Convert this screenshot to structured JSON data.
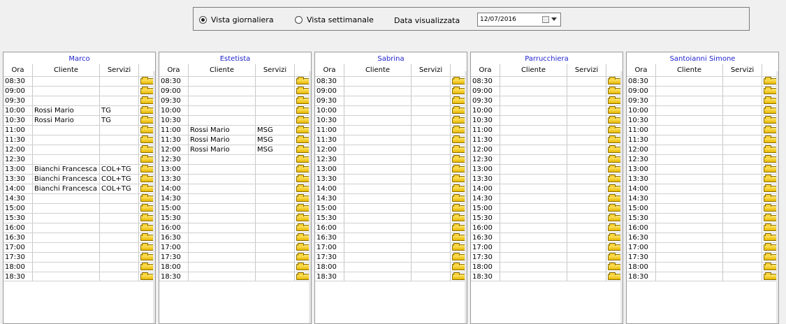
{
  "toolbar": {
    "view_daily_label": "Vista giornaliera",
    "view_daily_selected": true,
    "view_weekly_label": "Vista settimanale",
    "view_weekly_selected": false,
    "date_caption": "Data visualizzata",
    "date_value": "12/07/2016",
    "calendar_icon": "calendar-icon",
    "dropdown_icon": "chevron-down-icon"
  },
  "columns_header": {
    "ora": "Ora",
    "cliente": "Cliente",
    "servizi": "Servizi"
  },
  "slot_icon": "folder-icon",
  "colors": {
    "staff_title": "#1f22cf",
    "folder": "#f2c80e"
  },
  "staff": [
    {
      "name": "Marco",
      "rows": [
        {
          "ora": "08:30",
          "cliente": "",
          "servizi": ""
        },
        {
          "ora": "09:00",
          "cliente": "",
          "servizi": ""
        },
        {
          "ora": "09:30",
          "cliente": "",
          "servizi": ""
        },
        {
          "ora": "10:00",
          "cliente": "Rossi Mario",
          "servizi": "TG"
        },
        {
          "ora": "10:30",
          "cliente": "Rossi Mario",
          "servizi": "TG"
        },
        {
          "ora": "11:00",
          "cliente": "",
          "servizi": ""
        },
        {
          "ora": "11:30",
          "cliente": "",
          "servizi": ""
        },
        {
          "ora": "12:00",
          "cliente": "",
          "servizi": ""
        },
        {
          "ora": "12:30",
          "cliente": "",
          "servizi": ""
        },
        {
          "ora": "13:00",
          "cliente": "Bianchi Francesca",
          "servizi": "COL+TG"
        },
        {
          "ora": "13:30",
          "cliente": "Bianchi Francesca",
          "servizi": "COL+TG"
        },
        {
          "ora": "14:00",
          "cliente": "Bianchi Francesca",
          "servizi": "COL+TG"
        },
        {
          "ora": "14:30",
          "cliente": "",
          "servizi": ""
        },
        {
          "ora": "15:00",
          "cliente": "",
          "servizi": ""
        },
        {
          "ora": "15:30",
          "cliente": "",
          "servizi": ""
        },
        {
          "ora": "16:00",
          "cliente": "",
          "servizi": ""
        },
        {
          "ora": "16:30",
          "cliente": "",
          "servizi": ""
        },
        {
          "ora": "17:00",
          "cliente": "",
          "servizi": ""
        },
        {
          "ora": "17:30",
          "cliente": "",
          "servizi": ""
        },
        {
          "ora": "18:00",
          "cliente": "",
          "servizi": ""
        },
        {
          "ora": "18:30",
          "cliente": "",
          "servizi": ""
        }
      ]
    },
    {
      "name": "Estetista",
      "rows": [
        {
          "ora": "08:30",
          "cliente": "",
          "servizi": ""
        },
        {
          "ora": "09:00",
          "cliente": "",
          "servizi": ""
        },
        {
          "ora": "09:30",
          "cliente": "",
          "servizi": ""
        },
        {
          "ora": "10:00",
          "cliente": "",
          "servizi": ""
        },
        {
          "ora": "10:30",
          "cliente": "",
          "servizi": ""
        },
        {
          "ora": "11:00",
          "cliente": "Rossi Mario",
          "servizi": "MSG"
        },
        {
          "ora": "11:30",
          "cliente": "Rossi Mario",
          "servizi": "MSG"
        },
        {
          "ora": "12:00",
          "cliente": "Rossi Mario",
          "servizi": "MSG"
        },
        {
          "ora": "12:30",
          "cliente": "",
          "servizi": ""
        },
        {
          "ora": "13:00",
          "cliente": "",
          "servizi": ""
        },
        {
          "ora": "13:30",
          "cliente": "",
          "servizi": ""
        },
        {
          "ora": "14:00",
          "cliente": "",
          "servizi": ""
        },
        {
          "ora": "14:30",
          "cliente": "",
          "servizi": ""
        },
        {
          "ora": "15:00",
          "cliente": "",
          "servizi": ""
        },
        {
          "ora": "15:30",
          "cliente": "",
          "servizi": ""
        },
        {
          "ora": "16:00",
          "cliente": "",
          "servizi": ""
        },
        {
          "ora": "16:30",
          "cliente": "",
          "servizi": ""
        },
        {
          "ora": "17:00",
          "cliente": "",
          "servizi": ""
        },
        {
          "ora": "17:30",
          "cliente": "",
          "servizi": ""
        },
        {
          "ora": "18:00",
          "cliente": "",
          "servizi": ""
        },
        {
          "ora": "18:30",
          "cliente": "",
          "servizi": ""
        }
      ]
    },
    {
      "name": "Sabrina",
      "rows": [
        {
          "ora": "08:30",
          "cliente": "",
          "servizi": ""
        },
        {
          "ora": "09:00",
          "cliente": "",
          "servizi": ""
        },
        {
          "ora": "09:30",
          "cliente": "",
          "servizi": ""
        },
        {
          "ora": "10:00",
          "cliente": "",
          "servizi": ""
        },
        {
          "ora": "10:30",
          "cliente": "",
          "servizi": ""
        },
        {
          "ora": "11:00",
          "cliente": "",
          "servizi": ""
        },
        {
          "ora": "11:30",
          "cliente": "",
          "servizi": ""
        },
        {
          "ora": "12:00",
          "cliente": "",
          "servizi": ""
        },
        {
          "ora": "12:30",
          "cliente": "",
          "servizi": ""
        },
        {
          "ora": "13:00",
          "cliente": "",
          "servizi": ""
        },
        {
          "ora": "13:30",
          "cliente": "",
          "servizi": ""
        },
        {
          "ora": "14:00",
          "cliente": "",
          "servizi": ""
        },
        {
          "ora": "14:30",
          "cliente": "",
          "servizi": ""
        },
        {
          "ora": "15:00",
          "cliente": "",
          "servizi": ""
        },
        {
          "ora": "15:30",
          "cliente": "",
          "servizi": ""
        },
        {
          "ora": "16:00",
          "cliente": "",
          "servizi": ""
        },
        {
          "ora": "16:30",
          "cliente": "",
          "servizi": ""
        },
        {
          "ora": "17:00",
          "cliente": "",
          "servizi": ""
        },
        {
          "ora": "17:30",
          "cliente": "",
          "servizi": ""
        },
        {
          "ora": "18:00",
          "cliente": "",
          "servizi": ""
        },
        {
          "ora": "18:30",
          "cliente": "",
          "servizi": ""
        }
      ]
    },
    {
      "name": "Parrucchiera",
      "rows": [
        {
          "ora": "08:30",
          "cliente": "",
          "servizi": ""
        },
        {
          "ora": "09:00",
          "cliente": "",
          "servizi": ""
        },
        {
          "ora": "09:30",
          "cliente": "",
          "servizi": ""
        },
        {
          "ora": "10:00",
          "cliente": "",
          "servizi": ""
        },
        {
          "ora": "10:30",
          "cliente": "",
          "servizi": ""
        },
        {
          "ora": "11:00",
          "cliente": "",
          "servizi": ""
        },
        {
          "ora": "11:30",
          "cliente": "",
          "servizi": ""
        },
        {
          "ora": "12:00",
          "cliente": "",
          "servizi": ""
        },
        {
          "ora": "12:30",
          "cliente": "",
          "servizi": ""
        },
        {
          "ora": "13:00",
          "cliente": "",
          "servizi": ""
        },
        {
          "ora": "13:30",
          "cliente": "",
          "servizi": ""
        },
        {
          "ora": "14:00",
          "cliente": "",
          "servizi": ""
        },
        {
          "ora": "14:30",
          "cliente": "",
          "servizi": ""
        },
        {
          "ora": "15:00",
          "cliente": "",
          "servizi": ""
        },
        {
          "ora": "15:30",
          "cliente": "",
          "servizi": ""
        },
        {
          "ora": "16:00",
          "cliente": "",
          "servizi": ""
        },
        {
          "ora": "16:30",
          "cliente": "",
          "servizi": ""
        },
        {
          "ora": "17:00",
          "cliente": "",
          "servizi": ""
        },
        {
          "ora": "17:30",
          "cliente": "",
          "servizi": ""
        },
        {
          "ora": "18:00",
          "cliente": "",
          "servizi": ""
        },
        {
          "ora": "18:30",
          "cliente": "",
          "servizi": ""
        }
      ]
    },
    {
      "name": "Santoianni Simone",
      "rows": [
        {
          "ora": "08:30",
          "cliente": "",
          "servizi": ""
        },
        {
          "ora": "09:00",
          "cliente": "",
          "servizi": ""
        },
        {
          "ora": "09:30",
          "cliente": "",
          "servizi": ""
        },
        {
          "ora": "10:00",
          "cliente": "",
          "servizi": ""
        },
        {
          "ora": "10:30",
          "cliente": "",
          "servizi": ""
        },
        {
          "ora": "11:00",
          "cliente": "",
          "servizi": ""
        },
        {
          "ora": "11:30",
          "cliente": "",
          "servizi": ""
        },
        {
          "ora": "12:00",
          "cliente": "",
          "servizi": ""
        },
        {
          "ora": "12:30",
          "cliente": "",
          "servizi": ""
        },
        {
          "ora": "13:00",
          "cliente": "",
          "servizi": ""
        },
        {
          "ora": "13:30",
          "cliente": "",
          "servizi": ""
        },
        {
          "ora": "14:00",
          "cliente": "",
          "servizi": ""
        },
        {
          "ora": "14:30",
          "cliente": "",
          "servizi": ""
        },
        {
          "ora": "15:00",
          "cliente": "",
          "servizi": ""
        },
        {
          "ora": "15:30",
          "cliente": "",
          "servizi": ""
        },
        {
          "ora": "16:00",
          "cliente": "",
          "servizi": ""
        },
        {
          "ora": "16:30",
          "cliente": "",
          "servizi": ""
        },
        {
          "ora": "17:00",
          "cliente": "",
          "servizi": ""
        },
        {
          "ora": "17:30",
          "cliente": "",
          "servizi": ""
        },
        {
          "ora": "18:00",
          "cliente": "",
          "servizi": ""
        },
        {
          "ora": "18:30",
          "cliente": "",
          "servizi": ""
        }
      ]
    }
  ]
}
